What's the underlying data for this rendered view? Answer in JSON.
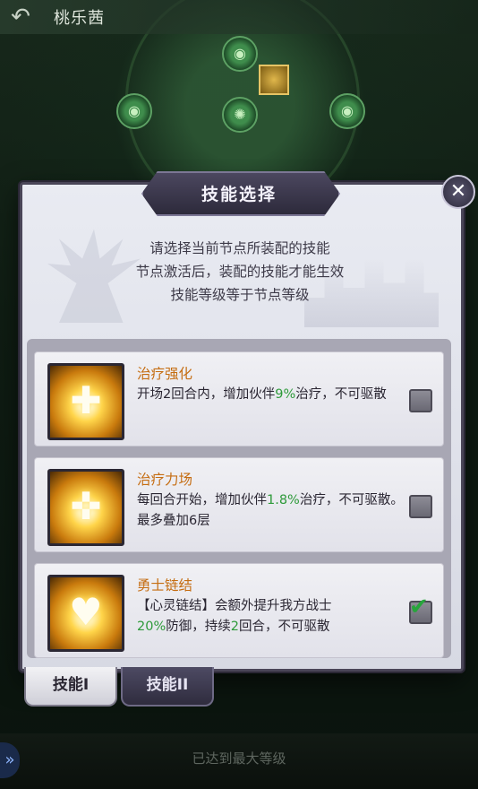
{
  "header": {
    "back_icon": "back-arrow-icon",
    "title": "桃乐茜"
  },
  "modal": {
    "title": "技能选择",
    "close_icon": "close-x-icon",
    "hints": [
      "请选择当前节点所装配的技能",
      "节点激活后，装配的技能才能生效",
      "技能等级等于节点等级"
    ]
  },
  "skills": [
    {
      "name": "治疗强化",
      "desc_parts": [
        "开场2回合内，增加伙伴",
        "9%",
        "治疗，不可驱散"
      ],
      "icon": "holy-cross-icon",
      "checked": false
    },
    {
      "name": "治疗力场",
      "desc_parts": [
        "每回合开始，增加伙伴",
        "1.8%",
        "治疗，不可驱散。最多叠加6层"
      ],
      "icon": "healing-field-icon",
      "checked": false
    },
    {
      "name": "勇士链结",
      "desc_parts": [
        "【心灵链结】会额外提升我方战士",
        "20%",
        "防御，持续",
        "2",
        "回合，不可驱散"
      ],
      "icon": "chain-heart-icon",
      "checked": true
    }
  ],
  "tabs": [
    {
      "label": "技能I",
      "active": true
    },
    {
      "label": "技能II",
      "active": false
    }
  ],
  "footer": {
    "status": "已达到最大等级",
    "side_icon": "double-chevron-right-icon"
  },
  "colors": {
    "skill_name": "#c56d12",
    "highlight": "#2e9a3a",
    "modal_bg": "#e2e3eb"
  }
}
